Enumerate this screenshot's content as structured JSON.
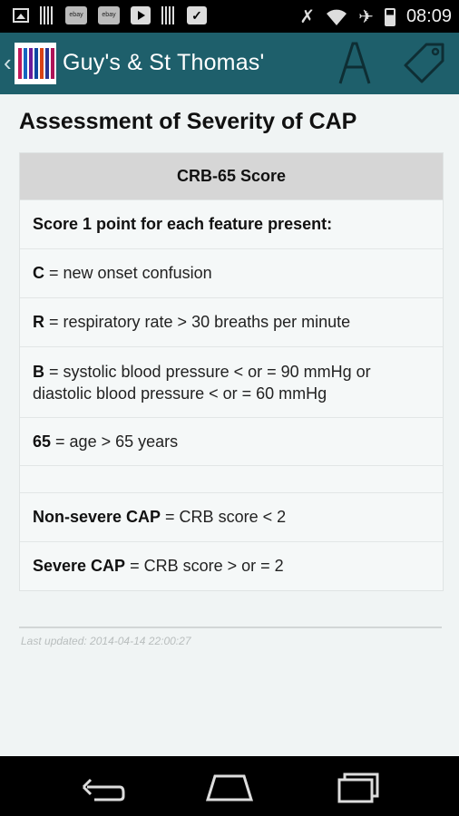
{
  "status_bar": {
    "time": "08:09",
    "notification_icons": [
      "image-icon",
      "barcode-icon",
      "ebay-icon",
      "ebay-icon",
      "play-store-icon",
      "barcode-icon",
      "checklist-icon"
    ],
    "ebay_label": "ebay",
    "system_icons": [
      "vibrate-off-icon",
      "wifi-icon",
      "airplane-icon",
      "battery-icon"
    ]
  },
  "action_bar": {
    "title": "Guy's & St Thomas'",
    "up_glyph": "‹",
    "color": "#1e5f6b"
  },
  "page": {
    "title": "Assessment of Severity of CAP",
    "table_header": "CRB-65 Score",
    "intro": "Score 1 point for each feature present:",
    "criteria": [
      {
        "key": "C",
        "text": " = new onset confusion"
      },
      {
        "key": "R",
        "text": " = respiratory rate > 30 breaths per minute"
      },
      {
        "key": "B",
        "text": " = systolic blood pressure < or = 90 mmHg or diastolic blood pressure < or = 60 mmHg"
      },
      {
        "key": "65",
        "text": " = age > 65 years"
      }
    ],
    "outcomes": [
      {
        "key": "Non-severe CAP",
        "text": " = CRB score < 2"
      },
      {
        "key": "Severe CAP",
        "text": " = CRB score > or = 2"
      }
    ],
    "last_updated": "Last updated: 2014-04-14 22:00:27"
  }
}
